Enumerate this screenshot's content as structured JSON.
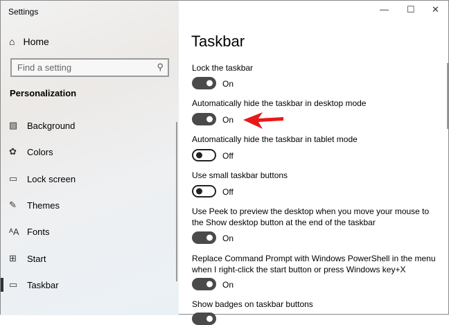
{
  "window": {
    "title": "Settings",
    "controls": [
      "minimize",
      "maximize",
      "close"
    ]
  },
  "sidebar": {
    "home": "Home",
    "search_placeholder": "Find a setting",
    "section": "Personalization",
    "items": [
      {
        "label": "Background",
        "icon": "image-icon"
      },
      {
        "label": "Colors",
        "icon": "palette-icon"
      },
      {
        "label": "Lock screen",
        "icon": "lock-screen-icon"
      },
      {
        "label": "Themes",
        "icon": "themes-icon"
      },
      {
        "label": "Fonts",
        "icon": "fonts-icon"
      },
      {
        "label": "Start",
        "icon": "start-icon"
      },
      {
        "label": "Taskbar",
        "icon": "taskbar-icon",
        "active": true
      }
    ]
  },
  "main": {
    "title": "Taskbar",
    "settings": [
      {
        "label": "Lock the taskbar",
        "state": "On"
      },
      {
        "label": "Automatically hide the taskbar in desktop mode",
        "state": "On"
      },
      {
        "label": "Automatically hide the taskbar in tablet mode",
        "state": "Off"
      },
      {
        "label": "Use small taskbar buttons",
        "state": "Off"
      },
      {
        "label": "Use Peek to preview the desktop when you move your mouse to the Show desktop button at the end of the taskbar",
        "state": "On"
      },
      {
        "label": "Replace Command Prompt with Windows PowerShell in the menu when I right-click the start button or press Windows key+X",
        "state": "On"
      },
      {
        "label": "Show badges on taskbar buttons"
      }
    ]
  },
  "annotation": {
    "color": "#e8191a"
  }
}
